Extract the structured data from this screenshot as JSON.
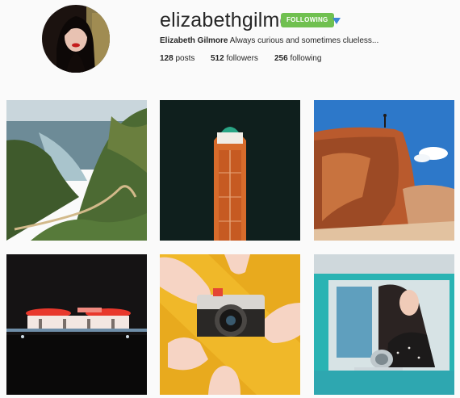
{
  "profile": {
    "username": "elizabethgilmore",
    "follow_label": "FOLLOWING",
    "full_name": "Elizabeth Gilmore",
    "bio": "Always curious and sometimes clueless..."
  },
  "stats": [
    {
      "count": "128",
      "label": "posts"
    },
    {
      "count": "512",
      "label": "followers"
    },
    {
      "count": "256",
      "label": "following"
    }
  ],
  "colors": {
    "follow_green": "#70c050",
    "dropdown_blue": "#3f87d6",
    "background": "#fafafa",
    "text": "#262626"
  },
  "posts": [
    {
      "subject": "coastal cliffs and winding trail"
    },
    {
      "subject": "orange cargo ship aerial view"
    },
    {
      "subject": "sandstone cliff with lone figure"
    },
    {
      "subject": "illuminated building at night"
    },
    {
      "subject": "hands holding camera on yellow"
    },
    {
      "subject": "woman in vintage car window"
    }
  ]
}
